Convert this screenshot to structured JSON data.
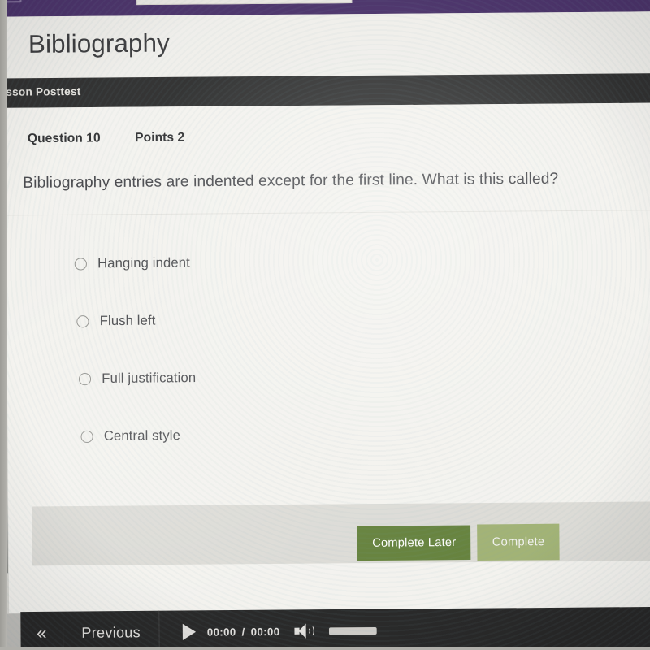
{
  "appbar": {
    "color": "#4a3269",
    "icons": [
      "menu-icon",
      "more-icon",
      "arrow-icon"
    ],
    "search_value": "",
    "search_placeholder": ""
  },
  "header": {
    "title": "Bibliography"
  },
  "section": {
    "label": "Lesson Posttest",
    "bar_color": "#2e2e2e"
  },
  "question": {
    "number_label": "Question 10",
    "points_label": "Points 2",
    "text": "Bibliography entries are indented except for the first line. What is this called?",
    "options": [
      {
        "label": "Hanging indent",
        "selected": false
      },
      {
        "label": "Flush left",
        "selected": false
      },
      {
        "label": "Full justification",
        "selected": false
      },
      {
        "label": "Central style",
        "selected": false
      }
    ]
  },
  "actions": {
    "complete_later_label": "Complete Later",
    "complete_label": "Complete",
    "primary_color": "#63803a",
    "secondary_color": "#a0b173"
  },
  "player": {
    "previous_icon": "«",
    "previous_label": "Previous",
    "play_icon": "play-icon",
    "current_time": "00:00",
    "time_separator": "/",
    "total_time": "00:00",
    "volume_icon": "speaker-icon",
    "volume_level": 100
  }
}
